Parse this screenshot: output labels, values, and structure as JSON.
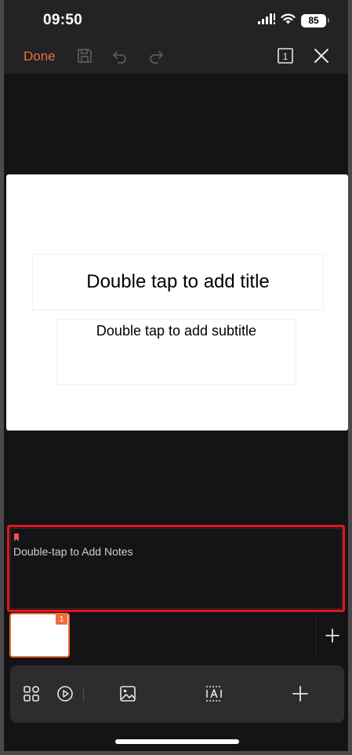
{
  "status_bar": {
    "time": "09:50",
    "battery": "85",
    "icons": [
      "cellular-signal-icon",
      "wifi-icon",
      "battery-icon"
    ]
  },
  "toolbar": {
    "done_label": "Done",
    "icons": [
      "save-icon",
      "undo-icon",
      "redo-icon",
      "slide-count-icon",
      "close-icon"
    ],
    "slide_count": "1",
    "accent_color": "#ee6d3a"
  },
  "slide": {
    "title_placeholder": "Double tap to add title",
    "subtitle_placeholder": "Double tap to add subtitle"
  },
  "notes": {
    "placeholder": "Double-tap to Add Notes",
    "highlight_color": "#e8121c"
  },
  "thumbnails": [
    {
      "number": "1",
      "selected": true
    }
  ],
  "bottom_toolbar": {
    "icons": [
      "slides-grid-icon",
      "play-icon",
      "insert-image-icon",
      "text-box-icon",
      "add-icon"
    ]
  }
}
